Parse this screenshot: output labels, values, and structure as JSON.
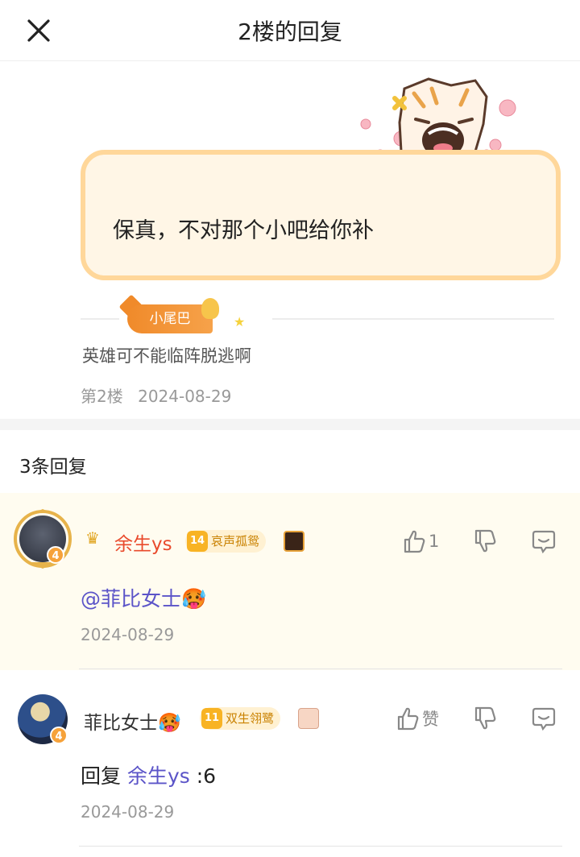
{
  "header": {
    "title": "2楼的回复"
  },
  "floor": {
    "bubble_text": "保真，不对那个小吧给你补",
    "tail_badge": "小尾巴",
    "tail_text": "英雄可不能临阵脱逃啊",
    "floor_label": "第2楼",
    "date": "2024-08-29"
  },
  "replies_header": "3条回复",
  "replies": [
    {
      "username": "余生ys",
      "user_level": "4",
      "forum_level": "14",
      "forum_title": "哀声孤鸳",
      "like_count": "1",
      "mention": "@菲比女士",
      "emoji": "🥵",
      "date": "2024-08-29"
    },
    {
      "username": "菲比女士",
      "emoji": "🥵",
      "user_level": "4",
      "forum_level": "11",
      "forum_title": "双生翎鹭",
      "like_label": "赞",
      "reply_prefix": "回复",
      "reply_to": "余生ys",
      "reply_text": ":6",
      "date": "2024-08-29"
    }
  ],
  "colors": {
    "accent": "#f08a2a",
    "mention": "#5b54c8",
    "username_vip": "#e94a2c"
  }
}
